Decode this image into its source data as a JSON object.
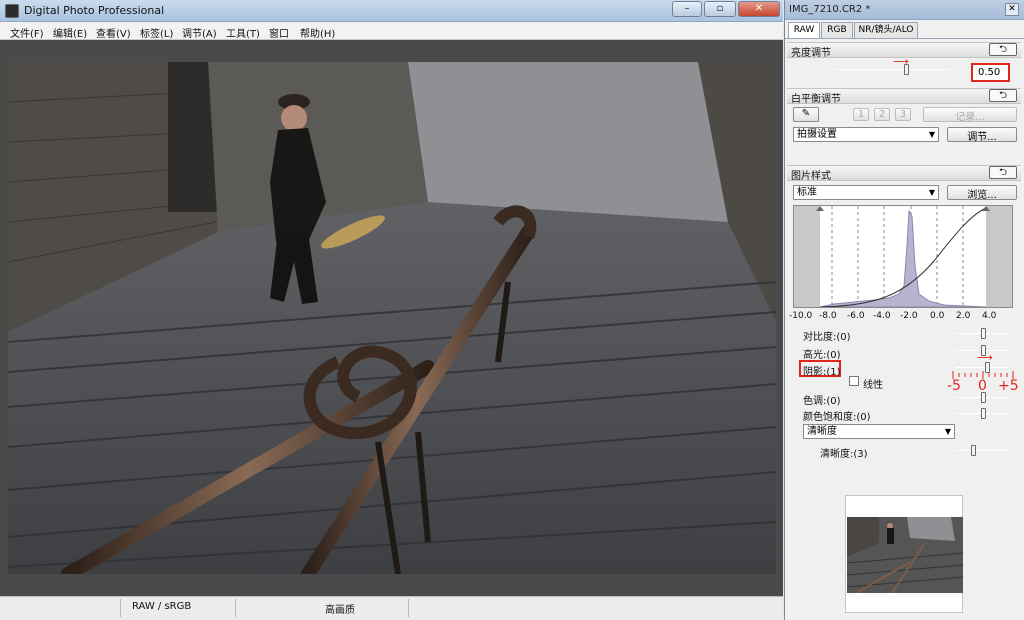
{
  "main_window": {
    "title": "Digital Photo Professional",
    "controls": {
      "minimize": "–",
      "restore": "▫",
      "close": "✕"
    },
    "menu": [
      "文件(F)",
      "编辑(E)",
      "查看(V)",
      "标签(L)",
      "调节(A)",
      "工具(T)",
      "窗口",
      "帮助(H)"
    ],
    "status": {
      "color_space": "RAW / sRGB",
      "quality": "高画质"
    }
  },
  "panel": {
    "title": "IMG_7210.CR2 *",
    "close": "✕",
    "tabs": [
      "RAW",
      "RGB",
      "NR/镜头/ALO"
    ],
    "brightness": {
      "label": "亮度调节",
      "value": "0.50",
      "reset": "⮌",
      "slider_fraction": 0.62
    },
    "white_balance": {
      "label": "白平衡调节",
      "reset": "⮌",
      "eyedropper": "eyedropper-icon",
      "presets": [
        "1",
        "2",
        "3"
      ],
      "register": "记录...",
      "mode": "拍摄设置",
      "adjust": "调节..."
    },
    "picture_style": {
      "label": "图片样式",
      "reset": "⮌",
      "style": "标准",
      "browse": "浏览...",
      "histogram_ticks": [
        "-10.0",
        "-8.0",
        "-6.0",
        "-4.0",
        "-2.0",
        "0.0",
        "2.0",
        "4.0"
      ]
    },
    "adjustments": {
      "contrast": {
        "label": "对比度:(0)",
        "value": 0
      },
      "highlight": {
        "label": "高光:(0)",
        "value": 0
      },
      "shadow": {
        "label": "阴影:(1)",
        "value": 1
      },
      "linear": {
        "label": "线性",
        "checked": false
      },
      "tone": {
        "label": "色调:(0)",
        "value": 0
      },
      "saturation": {
        "label": "颜色饱和度:(0)",
        "value": 0
      },
      "sharpness_mode": "清晰度",
      "sharpness": {
        "label": "清晰度:(3)",
        "value": 3
      }
    },
    "shadow_scale": {
      "min": "-5",
      "mid": "0",
      "max": "+5"
    }
  },
  "colors": {
    "annotation": "#e0261f",
    "histogram_fill": "#b8b4d0"
  }
}
